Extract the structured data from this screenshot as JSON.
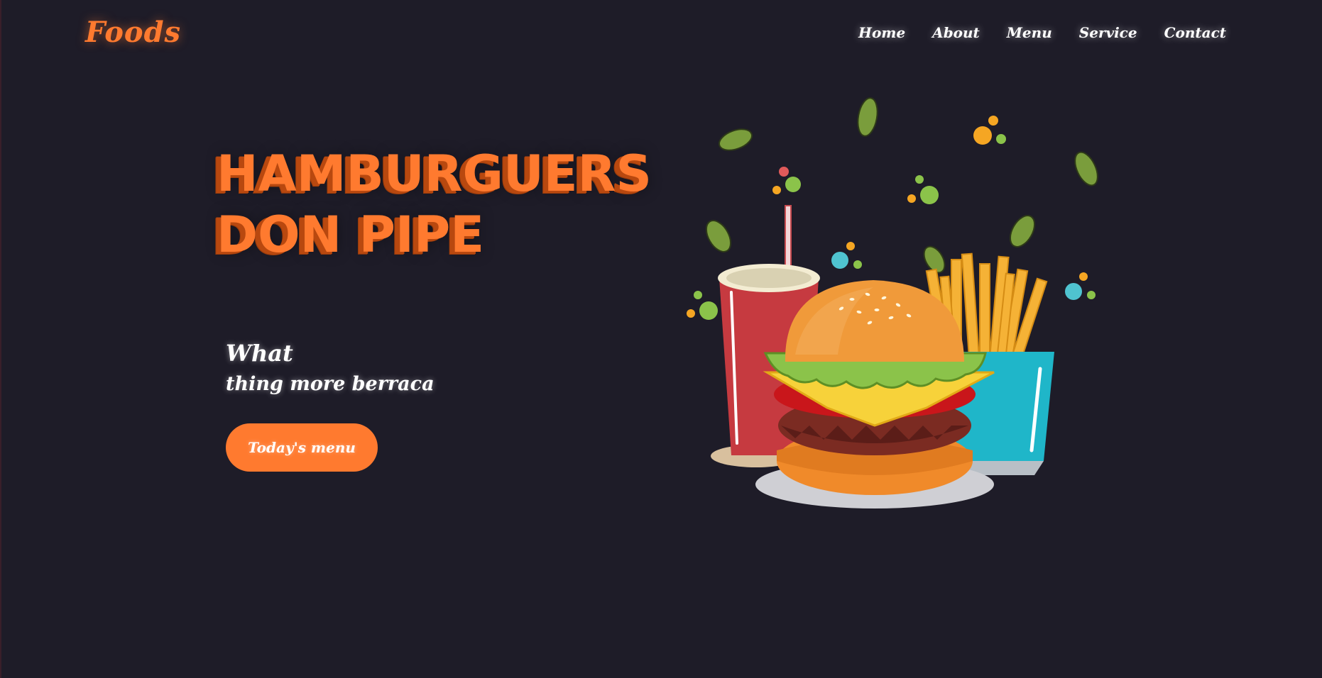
{
  "nav": {
    "logo": "Foods",
    "links": [
      "Home",
      "About",
      "Menu",
      "Service",
      "Contact"
    ]
  },
  "hero": {
    "title_line1": "HAMBURGUERS",
    "title_line2": "DON PIPE",
    "subtitle_line1": "What",
    "subtitle_line2": "thing more berraca",
    "cta_label": "Today's menu"
  },
  "illustration": {
    "icons": [
      "soda-cup-icon",
      "burger-icon",
      "fries-icon",
      "leaf-icon"
    ]
  },
  "colors": {
    "background": "#1e1c28",
    "accent": "#ff7a2f",
    "text": "#ffffff"
  }
}
